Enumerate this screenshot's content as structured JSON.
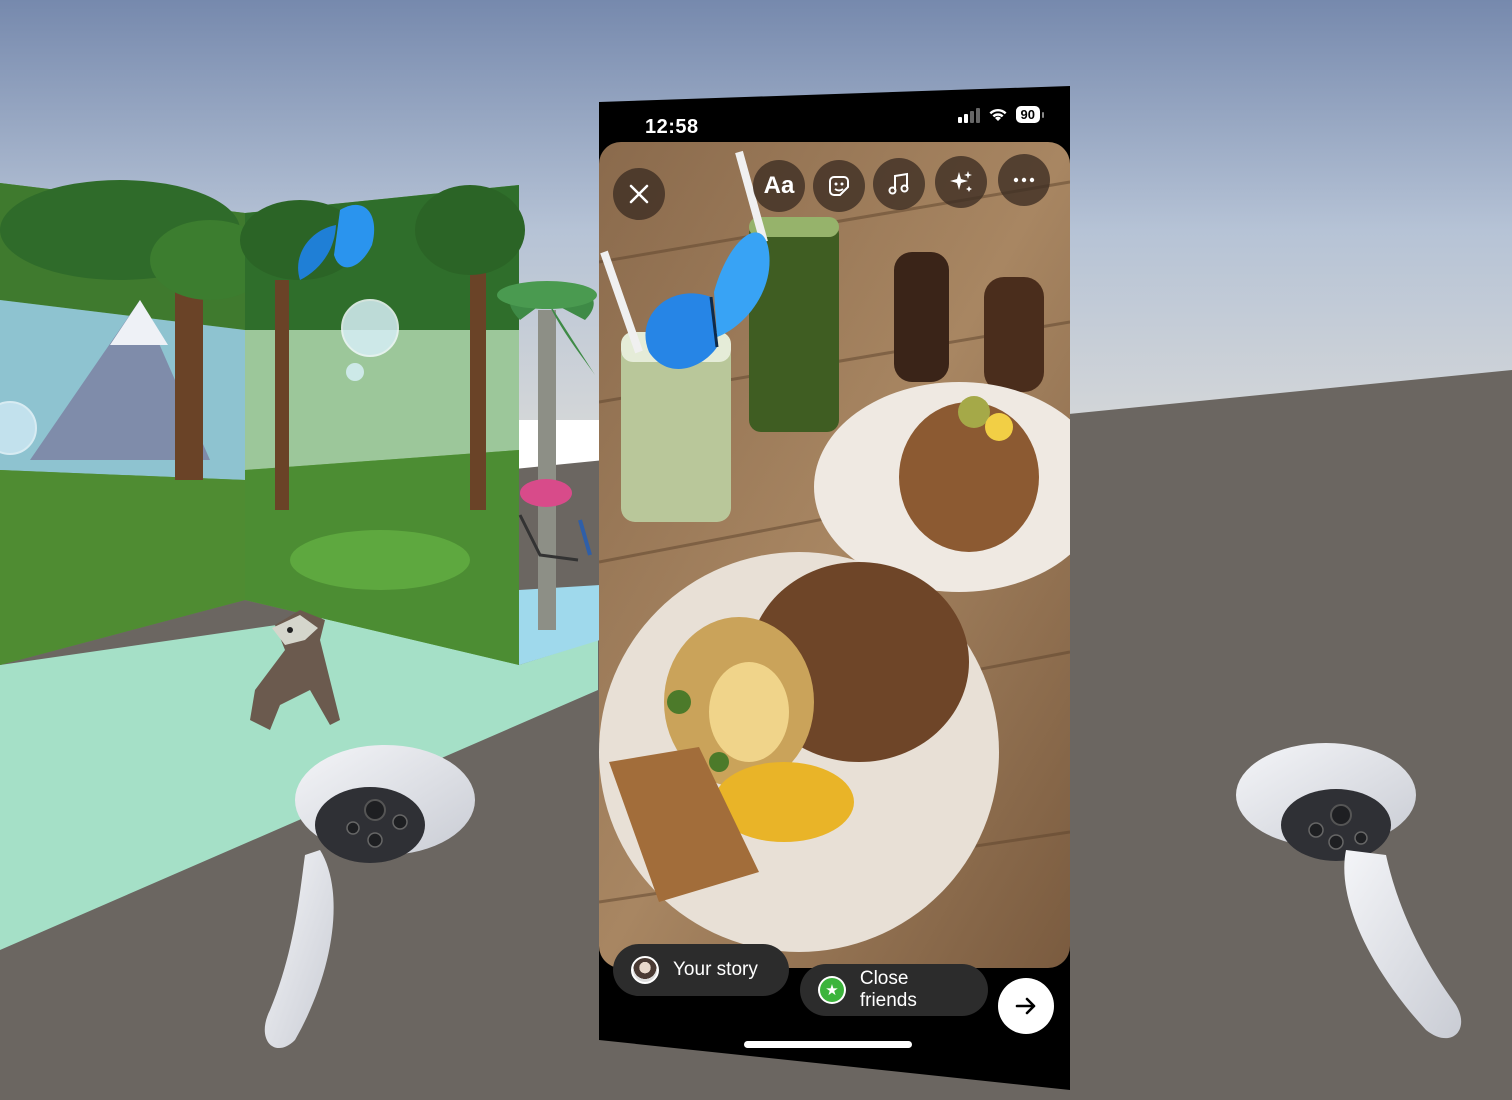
{
  "status_bar": {
    "time": "12:58",
    "battery": "90",
    "signal_icon": "cellular-signal-icon",
    "wifi_icon": "wifi-icon"
  },
  "toolbar": {
    "close_icon": "close-icon",
    "text_label": "Aa",
    "sticker_icon": "sticker-icon",
    "music_icon": "music-note-icon",
    "effects_icon": "sparkles-icon",
    "more_icon": "more-dots-icon"
  },
  "share": {
    "your_story_label": "Your story",
    "close_friends_label": "Close friends",
    "next_icon": "arrow-right-icon"
  },
  "colors": {
    "sky_top": "#7d8fb3",
    "sky_bottom": "#c8d0d8",
    "ground": "#6b6661",
    "phone_bg": "#000000",
    "pill_bg": "#2c2c2c",
    "close_friends_green": "#3cb43c"
  }
}
